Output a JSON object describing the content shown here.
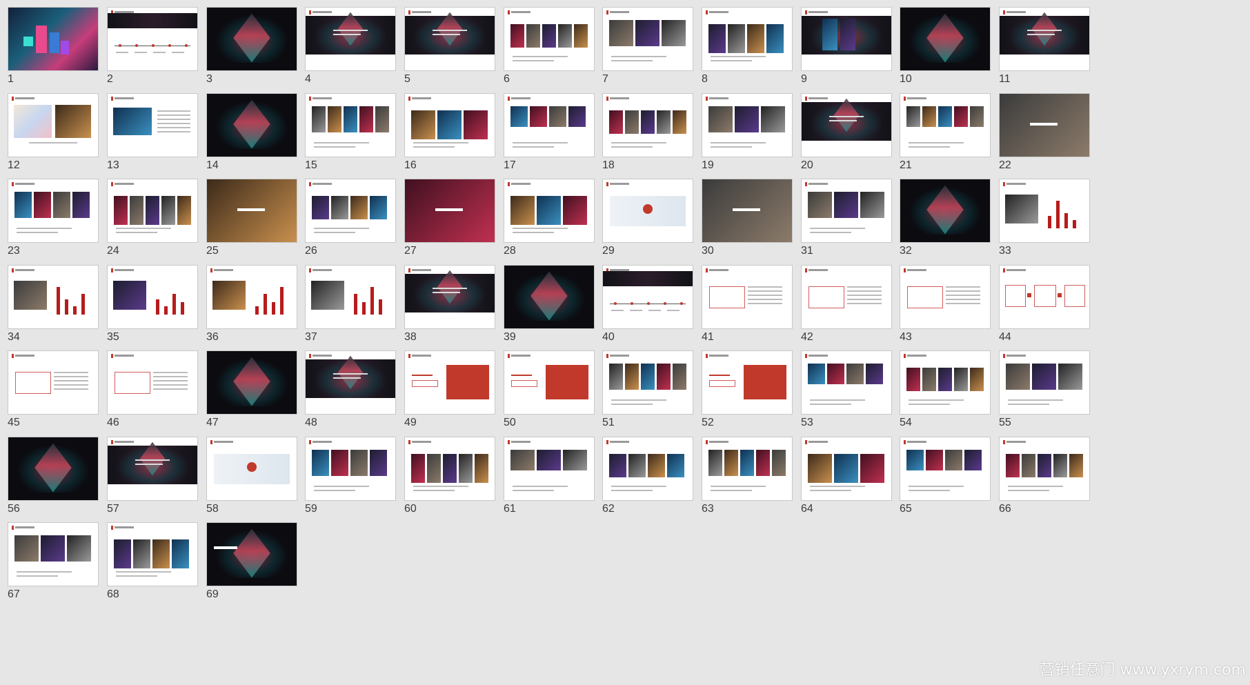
{
  "app": {
    "view": "slide-sorter"
  },
  "slides": [
    {
      "num": "1",
      "style": "hero"
    },
    {
      "num": "2",
      "style": "timeline"
    },
    {
      "num": "3",
      "style": "cover"
    },
    {
      "num": "4",
      "style": "cover-title"
    },
    {
      "num": "5",
      "style": "cover-title"
    },
    {
      "num": "6",
      "style": "photos"
    },
    {
      "num": "7",
      "style": "photos"
    },
    {
      "num": "8",
      "style": "photos"
    },
    {
      "num": "9",
      "style": "cover-photos"
    },
    {
      "num": "10",
      "style": "cover"
    },
    {
      "num": "11",
      "style": "cover-text"
    },
    {
      "num": "12",
      "style": "map"
    },
    {
      "num": "13",
      "style": "photo-text"
    },
    {
      "num": "14",
      "style": "cover"
    },
    {
      "num": "15",
      "style": "photos"
    },
    {
      "num": "16",
      "style": "photos"
    },
    {
      "num": "17",
      "style": "photos"
    },
    {
      "num": "18",
      "style": "photos"
    },
    {
      "num": "19",
      "style": "photos"
    },
    {
      "num": "20",
      "style": "cover-text"
    },
    {
      "num": "21",
      "style": "photos"
    },
    {
      "num": "22",
      "style": "fullphoto"
    },
    {
      "num": "23",
      "style": "photos"
    },
    {
      "num": "24",
      "style": "photos"
    },
    {
      "num": "25",
      "style": "fullphoto"
    },
    {
      "num": "26",
      "style": "photos"
    },
    {
      "num": "27",
      "style": "fullphoto"
    },
    {
      "num": "28",
      "style": "photos"
    },
    {
      "num": "29",
      "style": "diagram"
    },
    {
      "num": "30",
      "style": "fullphoto"
    },
    {
      "num": "31",
      "style": "photos"
    },
    {
      "num": "32",
      "style": "cover"
    },
    {
      "num": "33",
      "style": "barchart"
    },
    {
      "num": "34",
      "style": "barchart"
    },
    {
      "num": "35",
      "style": "barchart"
    },
    {
      "num": "36",
      "style": "barchart"
    },
    {
      "num": "37",
      "style": "barchart"
    },
    {
      "num": "38",
      "style": "cover-text"
    },
    {
      "num": "39",
      "style": "cover"
    },
    {
      "num": "40",
      "style": "timeline"
    },
    {
      "num": "41",
      "style": "boxes"
    },
    {
      "num": "42",
      "style": "boxes"
    },
    {
      "num": "43",
      "style": "boxes"
    },
    {
      "num": "44",
      "style": "flow"
    },
    {
      "num": "45",
      "style": "boxes"
    },
    {
      "num": "46",
      "style": "boxes"
    },
    {
      "num": "47",
      "style": "cover"
    },
    {
      "num": "48",
      "style": "cover-text"
    },
    {
      "num": "49",
      "style": "redpanel"
    },
    {
      "num": "50",
      "style": "redpanel"
    },
    {
      "num": "51",
      "style": "photos"
    },
    {
      "num": "52",
      "style": "redpanel"
    },
    {
      "num": "53",
      "style": "photos"
    },
    {
      "num": "54",
      "style": "photos"
    },
    {
      "num": "55",
      "style": "photos"
    },
    {
      "num": "56",
      "style": "cover"
    },
    {
      "num": "57",
      "style": "cover-text"
    },
    {
      "num": "58",
      "style": "diagram"
    },
    {
      "num": "59",
      "style": "photos"
    },
    {
      "num": "60",
      "style": "photos"
    },
    {
      "num": "61",
      "style": "photos"
    },
    {
      "num": "62",
      "style": "photos"
    },
    {
      "num": "63",
      "style": "photos"
    },
    {
      "num": "64",
      "style": "photos"
    },
    {
      "num": "65",
      "style": "photos"
    },
    {
      "num": "66",
      "style": "photos"
    },
    {
      "num": "67",
      "style": "photos"
    },
    {
      "num": "68",
      "style": "photos"
    },
    {
      "num": "69",
      "style": "cover-end"
    }
  ],
  "watermark": "营销任意门 www.yxrym.com",
  "colors": {
    "background": "#e6e6e6",
    "accent": "#c0392b",
    "dark": "#0b0b10"
  }
}
